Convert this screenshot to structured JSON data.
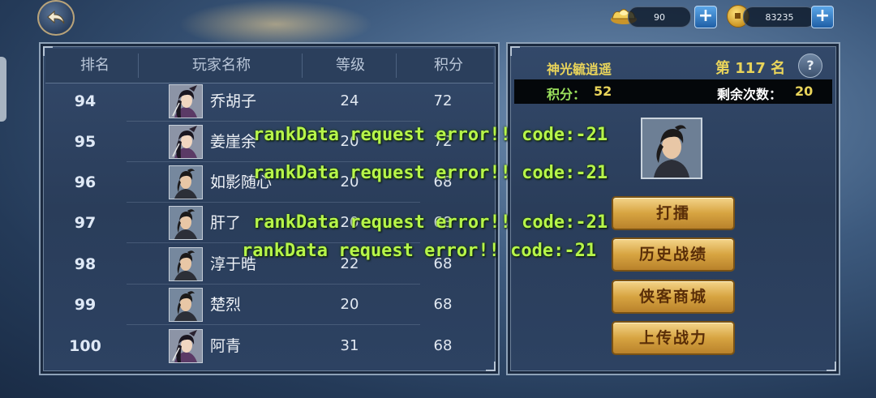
{
  "header": {
    "back_icon": "back-arrow-icon",
    "silver": {
      "icon": "ingot-icon",
      "value": "90",
      "add_icon": "plus-icon"
    },
    "coins": {
      "icon": "coin-icon",
      "value": "83235",
      "add_icon": "plus-icon"
    }
  },
  "ranking": {
    "columns": [
      "排名",
      "玩家名称",
      "等级",
      "积分"
    ],
    "rows": [
      {
        "rank": "94",
        "name": "乔胡子",
        "level": "24",
        "score": "72",
        "avatar": "female"
      },
      {
        "rank": "95",
        "name": "姜崖余",
        "level": "20",
        "score": "72",
        "avatar": "female"
      },
      {
        "rank": "96",
        "name": "如影随心",
        "level": "20",
        "score": "68",
        "avatar": "male"
      },
      {
        "rank": "97",
        "name": "肝了",
        "level": "20",
        "score": "68",
        "avatar": "male"
      },
      {
        "rank": "98",
        "name": "淳于晧",
        "level": "22",
        "score": "68",
        "avatar": "male"
      },
      {
        "rank": "99",
        "name": "楚烈",
        "level": "20",
        "score": "68",
        "avatar": "male"
      },
      {
        "rank": "100",
        "name": "阿青",
        "level": "31",
        "score": "68",
        "avatar": "female"
      }
    ]
  },
  "player": {
    "name": "神光毓逍遥",
    "rank_text": "第 117 名",
    "score_label": "积分：",
    "score_value": "52",
    "remaining_label": "剩余次数：",
    "remaining_value": "20",
    "help": "?"
  },
  "actions": [
    "打擂",
    "历史战绩",
    "侠客商城",
    "上传战力"
  ],
  "errors": [
    "rankData request error!! code:-21",
    "rankData request error!! code:-21",
    "rankData request error!! code:-21",
    "rankData request error!! code:-21"
  ],
  "colors": {
    "accent_gold": "#d7a441",
    "score_green": "#9be05c",
    "name_yellow": "#e9d45a",
    "error_green": "#b7f54a"
  }
}
